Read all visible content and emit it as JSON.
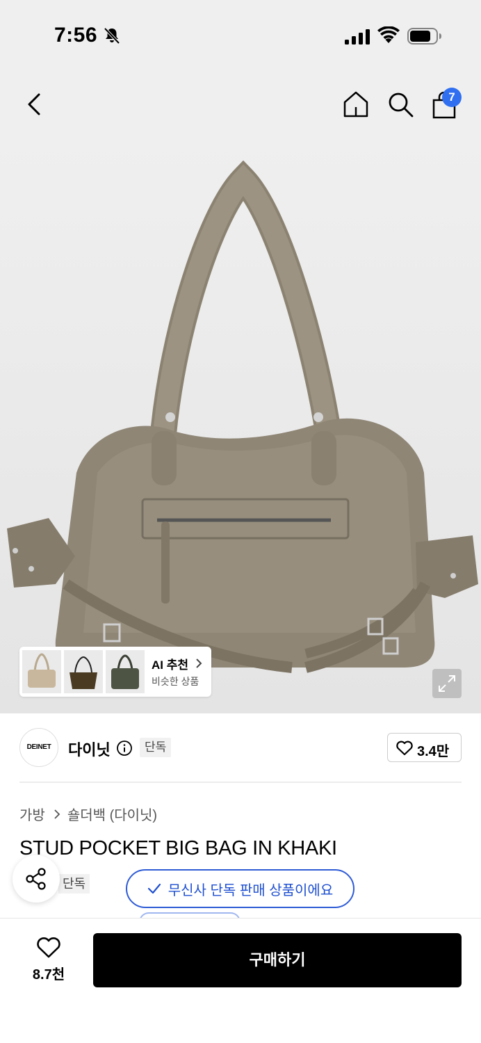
{
  "status_bar": {
    "time": "7:56"
  },
  "nav": {
    "cart_count": "7"
  },
  "ai_reco": {
    "title": "AI 추천",
    "subtitle": "비슷한 상품"
  },
  "brand": {
    "logo_text": "DEINET",
    "name": "다이닛",
    "tag": "단독",
    "likes": "3.4만"
  },
  "breadcrumb": {
    "category": "가방",
    "subcategory": "숄더백 (다이닛)"
  },
  "product": {
    "title": "STUD POCKET BIG BAG IN KHAKI",
    "tag": "단독"
  },
  "banner": {
    "text": "무신사 단독 판매 상품이에요",
    "accent": "#2e5bd6"
  },
  "bottom": {
    "wish_count": "8.7천",
    "buy_label": "구매하기"
  }
}
